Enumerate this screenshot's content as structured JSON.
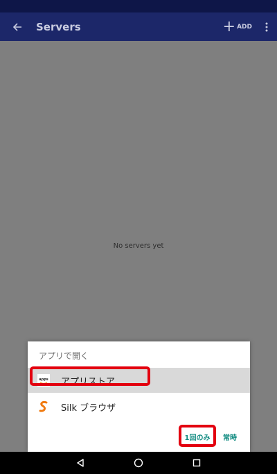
{
  "app_bar": {
    "title": "Servers",
    "add_label": "ADD"
  },
  "main": {
    "empty_text": "No servers yet"
  },
  "chooser": {
    "title": "アプリで開く",
    "apps": [
      {
        "label": "アプリストア",
        "icon": "apps-icon",
        "icon_text": "apps"
      },
      {
        "label": "Silk ブラウザ",
        "icon": "silk-icon"
      }
    ],
    "once_label": "1回のみ",
    "always_label": "常時"
  },
  "colors": {
    "app_bar": "#1c2769",
    "status_bar": "#0e1648",
    "accent": "#0f8a80",
    "highlight": "#e3000f",
    "scrim": "#7f7f7f"
  }
}
